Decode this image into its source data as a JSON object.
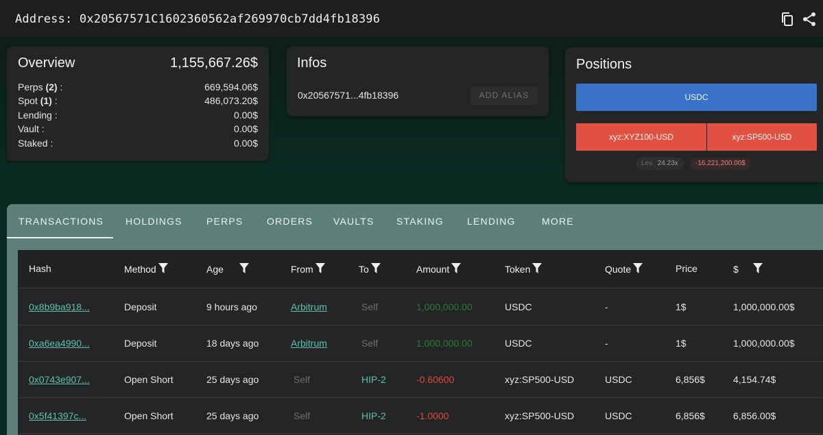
{
  "header": {
    "address_label": "Address: 0x20567571C1602360562af269970cb7dd4fb18396",
    "icons": [
      "copy-icon",
      "share-icon"
    ]
  },
  "overview": {
    "title": "Overview",
    "total": "1,155,667.26$",
    "rows": [
      {
        "label": "Perps",
        "count": "(2)",
        "suffix": " :",
        "value": "669,594.06$"
      },
      {
        "label": "Spot",
        "count": "(1)",
        "suffix": " :",
        "value": "486,073.20$"
      },
      {
        "label": "Lending :",
        "count": "",
        "suffix": "",
        "value": "0.00$"
      },
      {
        "label": "Vault :",
        "count": "",
        "suffix": "",
        "value": "0.00$"
      },
      {
        "label": "Staked :",
        "count": "",
        "suffix": "",
        "value": "0.00$"
      }
    ]
  },
  "infos": {
    "title": "Infos",
    "short_address": "0x20567571...4fb18396",
    "alias_button": "ADD ALIAS"
  },
  "positions": {
    "title": "Positions",
    "spot": "USDC",
    "perp1": "xyz:XYZ100-USD",
    "perp2": "xyz:SP500-USD",
    "lev_label": "Lev.",
    "lev_value": "24.23x",
    "pnl": "-16,221,200.00$",
    "colors": {
      "spot": "#3a72c8",
      "perp": "#e05142"
    }
  },
  "tabs": [
    "TRANSACTIONS",
    "HOLDINGS",
    "PERPS",
    "ORDERS",
    "VAULTS",
    "STAKING",
    "LENDING",
    "MORE"
  ],
  "table": {
    "columns": [
      "Hash",
      "Method",
      "Age",
      "From",
      "To",
      "Amount",
      "Token",
      "Quote",
      "Price",
      "$"
    ],
    "rows": [
      {
        "hash": "0x8b9ba918...",
        "method": "Deposit",
        "age": "9 hours ago",
        "from": "Arbitrum",
        "to": "Self",
        "amount": "1,000,000.00",
        "token": "USDC",
        "quote": "-",
        "price": "1$",
        "usd": "1,000,000.00$"
      },
      {
        "hash": "0xa6ea4990...",
        "method": "Deposit",
        "age": "18 days ago",
        "from": "Arbitrum",
        "to": "Self",
        "amount": "1,000,000.00",
        "token": "USDC",
        "quote": "-",
        "price": "1$",
        "usd": "1,000,000.00$"
      },
      {
        "hash": "0x0743e907...",
        "method": "Open Short",
        "age": "25 days ago",
        "from": "Self",
        "to": "HIP-2",
        "amount": "-0.60600",
        "token": "xyz:SP500-USD",
        "quote": "USDC",
        "price": "6,856$",
        "usd": "4,154.74$"
      },
      {
        "hash": "0x5f41397c...",
        "method": "Open Short",
        "age": "25 days ago",
        "from": "Self",
        "to": "HIP-2",
        "amount": "-1.0000",
        "token": "xyz:SP500-USD",
        "quote": "USDC",
        "price": "6,856$",
        "usd": "6,856.00$"
      }
    ]
  }
}
